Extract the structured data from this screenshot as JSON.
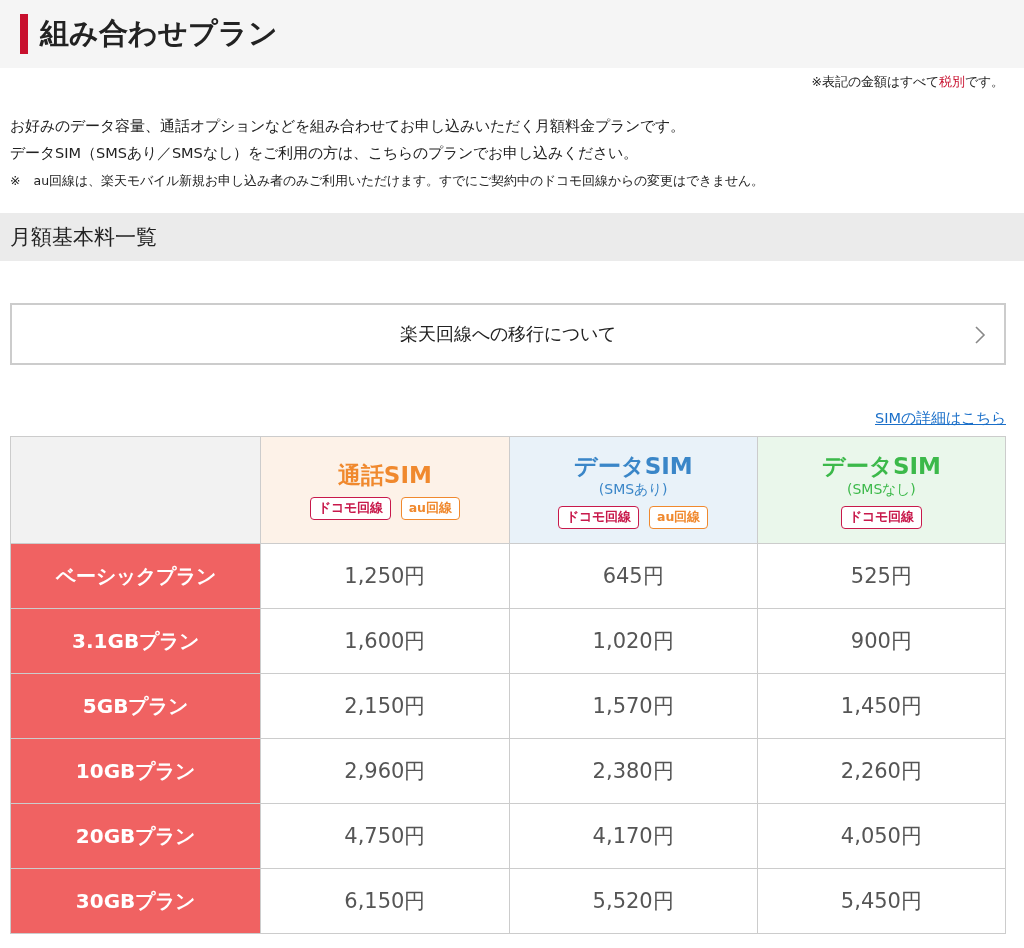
{
  "page_title": "組み合わせプラン",
  "tax_note": [
    {
      "text": "※表記の金額はすべて",
      "emphasis": false
    },
    {
      "text": "税別",
      "emphasis": true
    },
    {
      "text": "です。",
      "emphasis": false
    }
  ],
  "description": [
    "お好みのデータ容量、通話オプションなどを組み合わせてお申し込みいただく月額料金プランです。",
    "データSIM（SMSあり／SMSなし）をご利用の方は、こちらのプランでお申し込みください。"
  ],
  "footnote": "※　au回線は、楽天モバイル新規お申し込み者のみご利用いただけます。すでにご契約中のドコモ回線からの変更はできません。",
  "section_title": "月額基本料一覧",
  "migration_button": {
    "label": "楽天回線への移行について"
  },
  "details_link": "SIMの詳細はこちら",
  "table": {
    "columns": [
      {
        "name": "通話SIM",
        "color": "#f0892e",
        "tags": [
          {
            "label": "ドコモ回線",
            "color": "#c8194b"
          },
          {
            "label": "au回線",
            "color": "#f0892e"
          }
        ]
      },
      {
        "name": "データSIM",
        "subtitle": "(SMSあり)",
        "color": "#3a86c8",
        "tags": [
          {
            "label": "ドコモ回線",
            "color": "#c8194b"
          },
          {
            "label": "au回線",
            "color": "#f0892e"
          }
        ]
      },
      {
        "name": "データSIM",
        "subtitle": "(SMSなし)",
        "color": "#3cb94a",
        "tags": [
          {
            "label": "ドコモ回線",
            "color": "#c8194b"
          }
        ]
      }
    ],
    "rows": [
      {
        "plan": "ベーシックプラン",
        "prices": [
          "1,250円",
          "645円",
          "525円"
        ]
      },
      {
        "plan": "3.1GBプラン",
        "prices": [
          "1,600円",
          "1,020円",
          "900円"
        ]
      },
      {
        "plan": "5GBプラン",
        "prices": [
          "2,150円",
          "1,570円",
          "1,450円"
        ]
      },
      {
        "plan": "10GBプラン",
        "prices": [
          "2,960円",
          "2,380円",
          "2,260円"
        ]
      },
      {
        "plan": "20GBプラン",
        "prices": [
          "4,750円",
          "4,170円",
          "4,050円"
        ]
      },
      {
        "plan": "30GBプラン",
        "prices": [
          "6,150円",
          "5,520円",
          "5,450円"
        ]
      }
    ]
  }
}
